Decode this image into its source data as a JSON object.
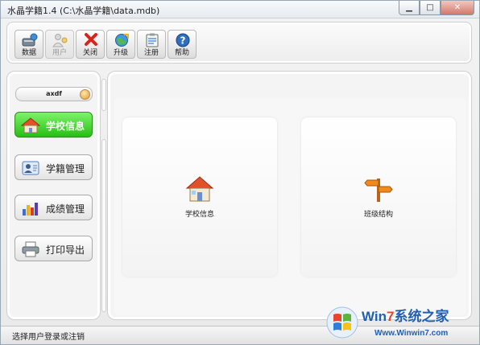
{
  "window": {
    "title": "水晶学籍1.4  (C:\\水晶学籍\\data.mdb)",
    "controls": [
      "minimize",
      "maximize",
      "close"
    ]
  },
  "toolbar": {
    "items": [
      {
        "label": "数据",
        "icon": "database-icon"
      },
      {
        "label": "用户",
        "icon": "users-icon",
        "state": "disabled"
      },
      {
        "label": "关闭",
        "icon": "close-x-icon"
      },
      {
        "label": "升级",
        "icon": "upgrade-globe-icon"
      },
      {
        "label": "注册",
        "icon": "register-clipboard-icon"
      },
      {
        "label": "帮助",
        "icon": "help-icon"
      }
    ]
  },
  "sidebar": {
    "user": "axdf",
    "items": [
      {
        "label": "学校信息",
        "icon": "school-house-icon",
        "active": true
      },
      {
        "label": "学籍管理",
        "icon": "student-card-icon",
        "active": false
      },
      {
        "label": "成绩管理",
        "icon": "bar-chart-icon",
        "active": false
      },
      {
        "label": "打印导出",
        "icon": "printer-icon",
        "active": false
      }
    ]
  },
  "main": {
    "cards": [
      {
        "label": "学校信息",
        "icon": "school-house-icon"
      },
      {
        "label": "班级结构",
        "icon": "signpost-icon"
      }
    ]
  },
  "status": {
    "text": "选择用户登录或注销"
  },
  "watermark": {
    "brand_prefix": "Win",
    "brand_digit": "7",
    "brand_suffix": "系统之家",
    "url": "Www.Winwin7.com"
  },
  "colors": {
    "active_nav": "#26bf13",
    "close_red": "#d9241c",
    "accent_orange": "#f08a1c",
    "watermark_blue": "#1f5fb4"
  }
}
